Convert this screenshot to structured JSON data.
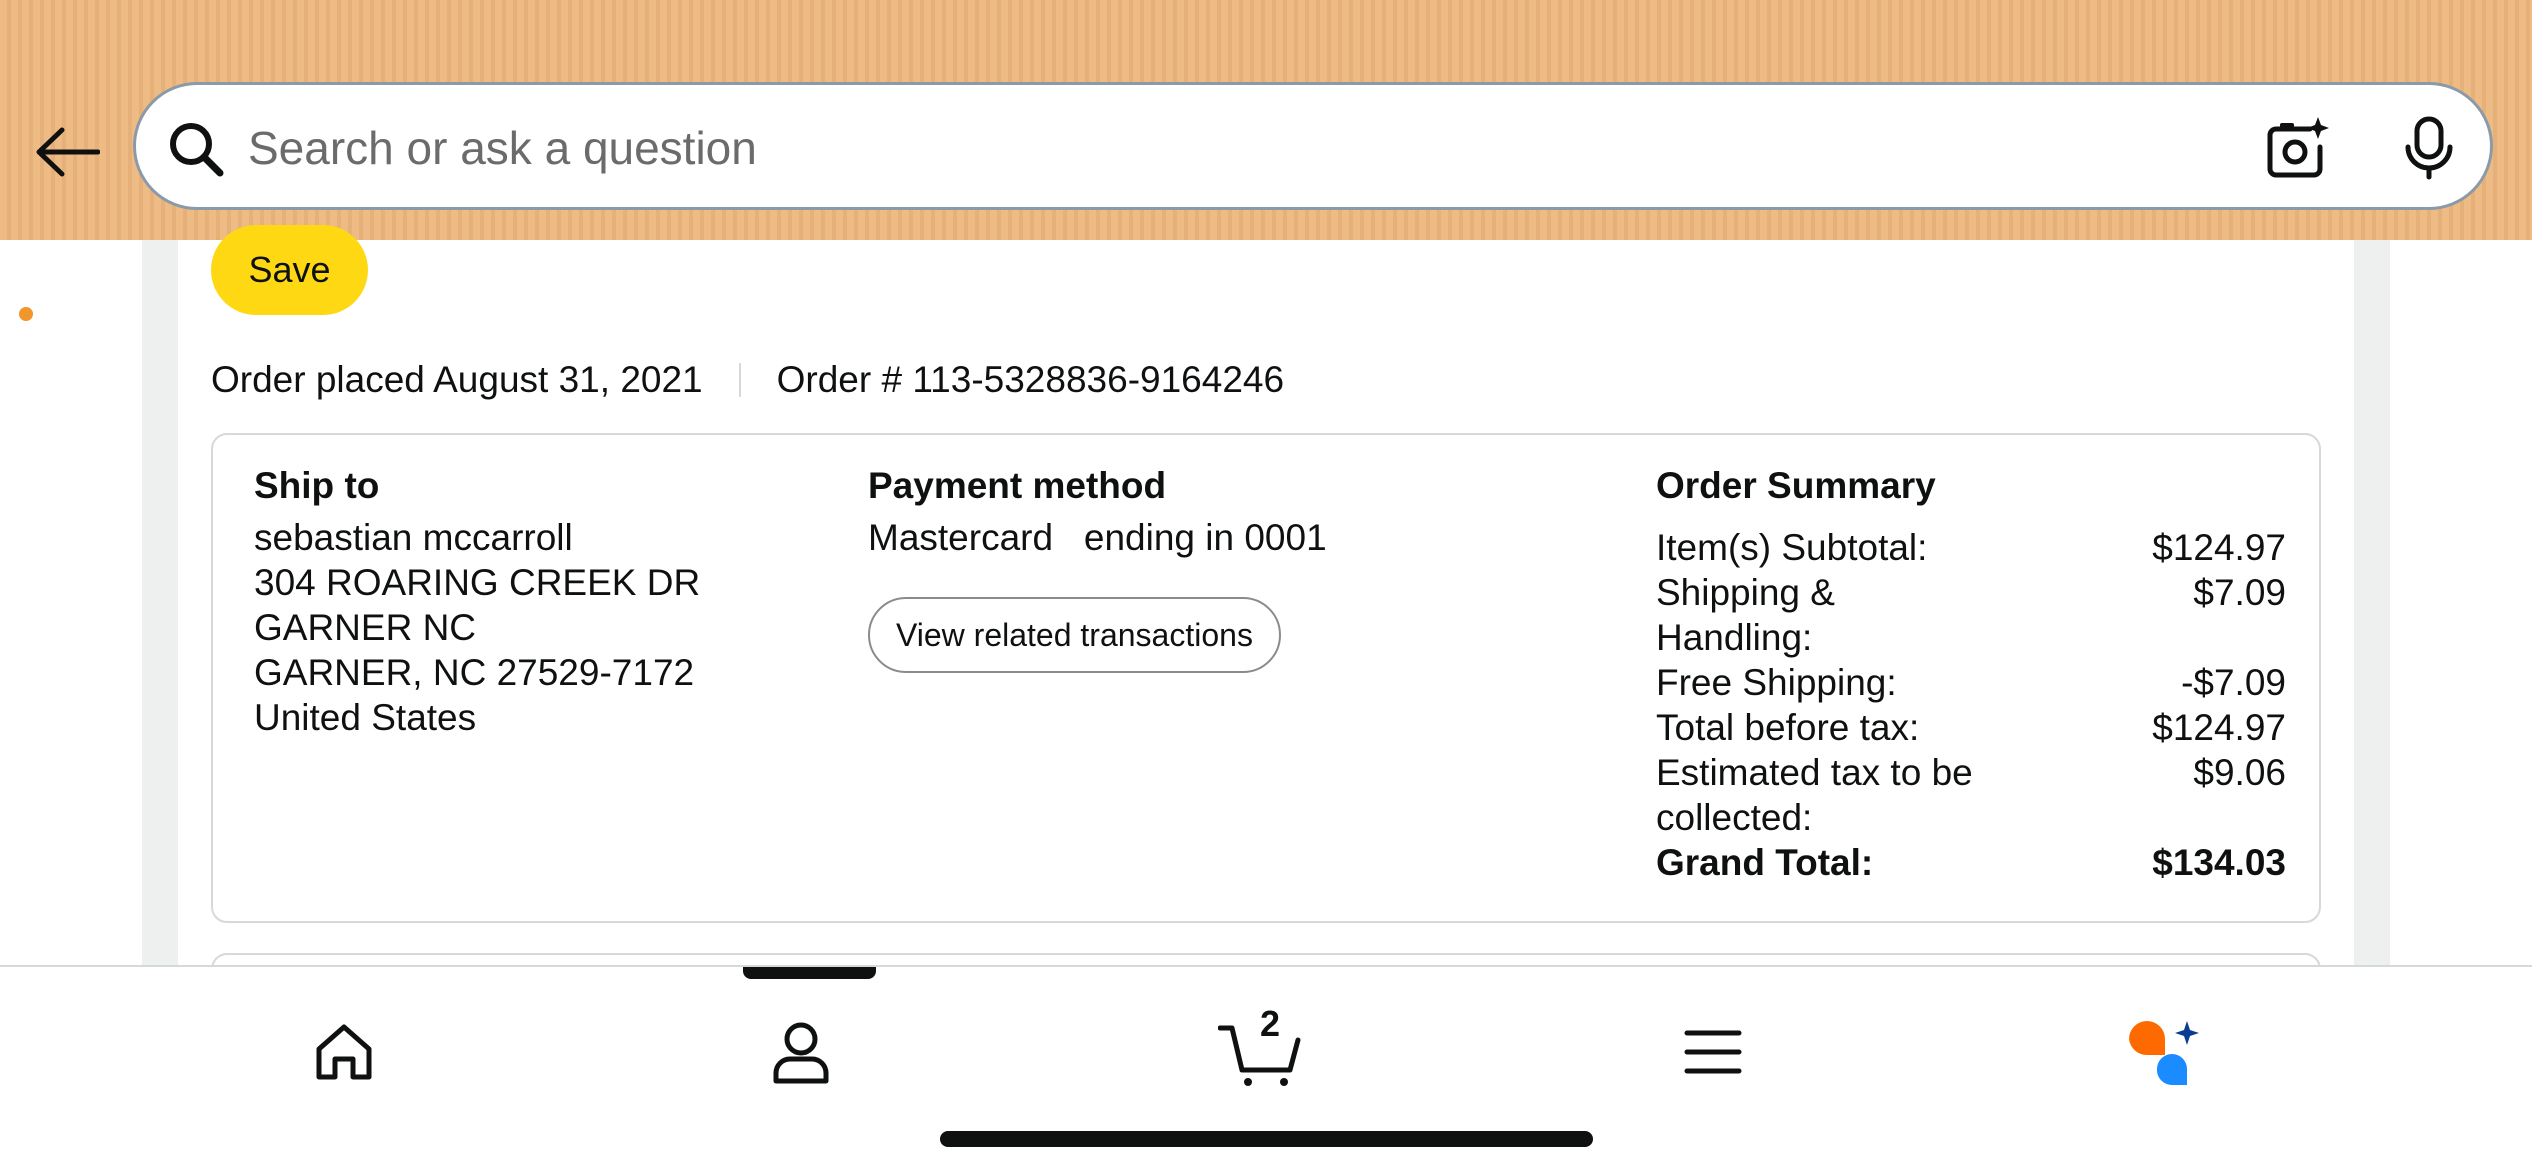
{
  "header": {
    "search_placeholder": "Search or ask a question"
  },
  "save_button": "Save",
  "order": {
    "placed": "Order placed August 31, 2021",
    "number": "Order # 113-5328836-9164246"
  },
  "ship_to": {
    "title": "Ship to",
    "lines": [
      "sebastian mccarroll",
      "304 ROARING CREEK DR",
      "GARNER NC",
      "GARNER, NC 27529-7172",
      "United States"
    ]
  },
  "payment": {
    "title": "Payment method",
    "method": "Mastercard   ending in 0001",
    "view_button": "View related transactions"
  },
  "summary": {
    "title": "Order Summary",
    "rows": [
      {
        "label": "Item(s) Subtotal:",
        "value": "$124.97"
      },
      {
        "label": "Shipping & Handling:",
        "value": "$7.09"
      },
      {
        "label": "Free Shipping:",
        "value": "-$7.09"
      },
      {
        "label": "Total before tax:",
        "value": "$124.97"
      },
      {
        "label": "Estimated tax to be collected:",
        "value": "$9.06"
      },
      {
        "label": "Grand Total:",
        "value": "$134.03"
      }
    ]
  },
  "bottom_nav": {
    "cart_count": "2",
    "items": [
      "home-icon",
      "account-icon",
      "cart-icon",
      "menu-icon",
      "rufus-icon"
    ]
  },
  "colors": {
    "header_bg": "#efbb84",
    "save_button": "#ffd814",
    "accent_orange": "#f0962b",
    "rufus_blue": "#1a8cff",
    "rufus_orange": "#ff6a00"
  }
}
